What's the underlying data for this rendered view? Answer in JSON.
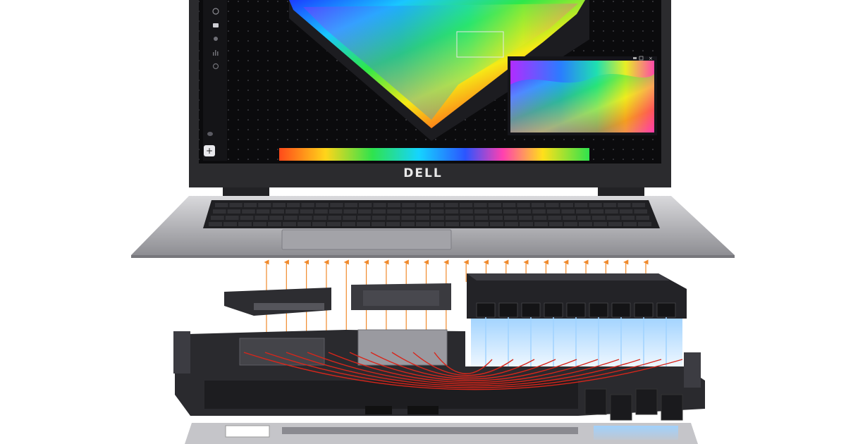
{
  "brand": {
    "logo_text": "DELL"
  },
  "colors": {
    "background": "#ffffff",
    "laptop_body": "#2b2b2e",
    "deck_silver": "#b8b8bc",
    "screen_bg": "#0b0b0d",
    "heat_red": "#d8261b",
    "airflow_orange": "#f08a2c",
    "cool_blue": "#9fd2ff"
  },
  "screen_ui": {
    "sidebar_icons": [
      "clock-icon",
      "briefcase-icon",
      "globe-icon",
      "bar-chart-icon",
      "gear-icon"
    ],
    "sidebar_bottom_icons": [
      "cloud-icon",
      "add-icon"
    ],
    "window_controls": [
      "minimize-icon",
      "restore-icon",
      "close-icon"
    ]
  },
  "illustration": {
    "up_arrow_count": 20,
    "heat_pipe_count": 10,
    "fan_blade_count": 9
  }
}
